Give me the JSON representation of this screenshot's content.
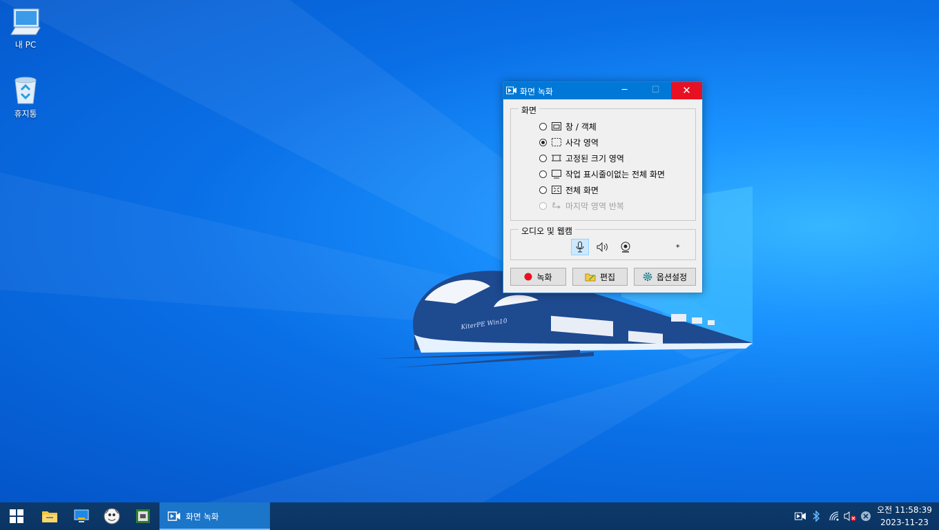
{
  "desktop": {
    "icons": [
      {
        "label": "내 PC"
      },
      {
        "label": "휴지통"
      }
    ],
    "wallpaper_text": "KiterPE Win10"
  },
  "dialog": {
    "title": "화면 녹화",
    "screen_group": {
      "title": "화면",
      "options": [
        {
          "label": "창 / 객체",
          "icon": "window-icon",
          "checked": false,
          "enabled": true
        },
        {
          "label": "사각 영역",
          "icon": "dashed-rect-icon",
          "checked": true,
          "enabled": true
        },
        {
          "label": "고정된 크기 영역",
          "icon": "fixed-rect-icon",
          "checked": false,
          "enabled": true
        },
        {
          "label": "작업 표시줄이없는 전체 화면",
          "icon": "monitor-icon",
          "checked": false,
          "enabled": true
        },
        {
          "label": "전체 화면",
          "icon": "fullscreen-icon",
          "checked": false,
          "enabled": true
        },
        {
          "label": "마지막 영역 반복",
          "icon": "repeat-icon",
          "checked": false,
          "enabled": false
        }
      ]
    },
    "av_group": {
      "title": "오디오 및 웹캠",
      "microphone_active": true,
      "asterisk": "*"
    },
    "buttons": {
      "record": "녹화",
      "edit": "편집",
      "options": "옵션설정"
    },
    "colors": {
      "titlebar": "#0078d7",
      "close": "#e81123",
      "record_dot": "#e81123"
    }
  },
  "taskbar": {
    "active_task": "화면 녹화",
    "clock": {
      "time": "오전 11:58:39",
      "date": "2023-11-23"
    }
  }
}
